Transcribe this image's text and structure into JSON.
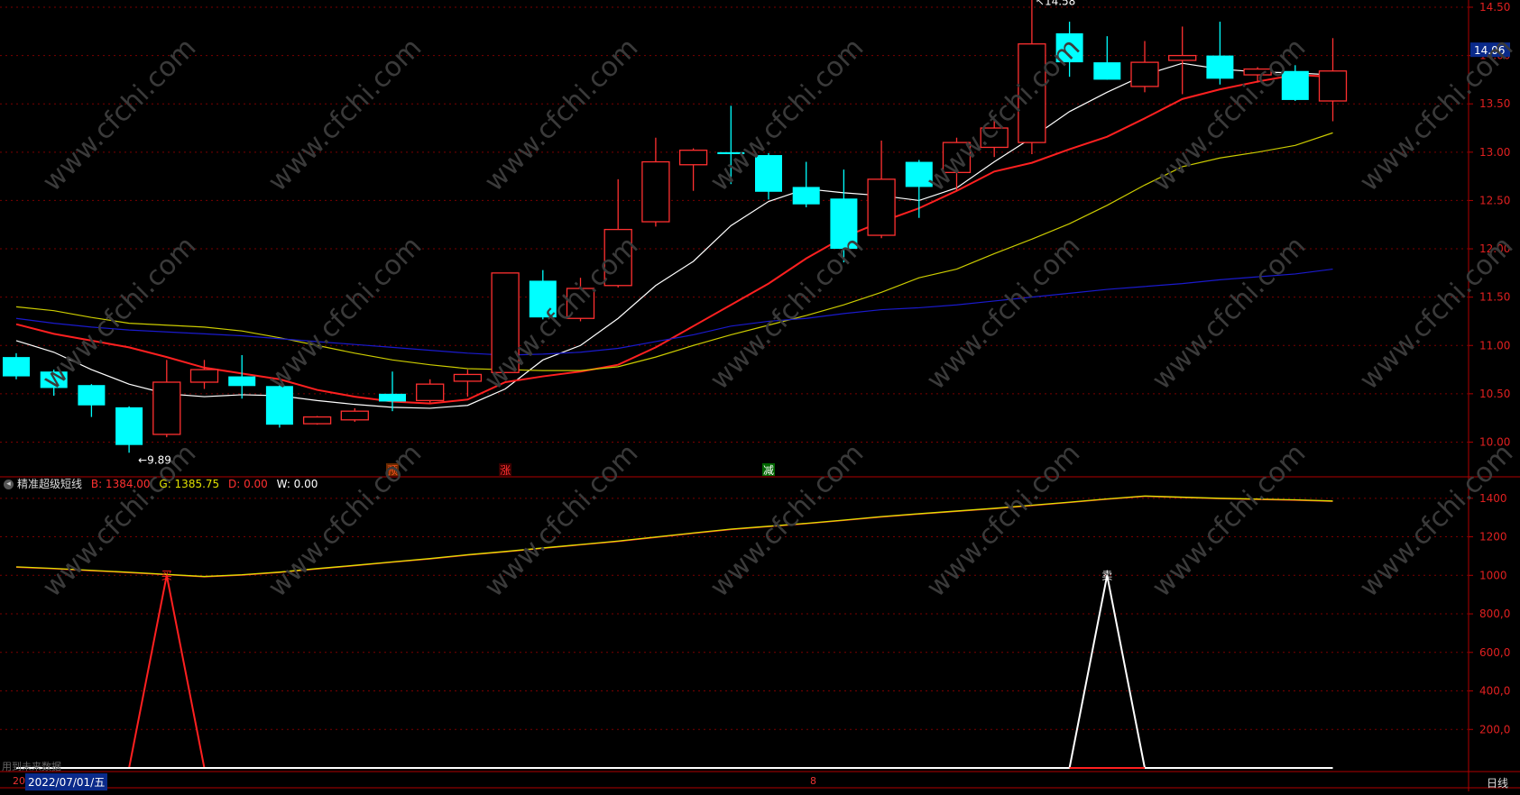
{
  "indicator": {
    "name": "精准超级短线",
    "toggle_icon": "collapse-icon",
    "b_label": "B: 1384.00",
    "g_label": "G: 1385.75",
    "d_label": "D: 0.00",
    "w_label": "W: 0.00",
    "b_color": "#ff3030",
    "g_color": "#e0e000",
    "d_color": "#ff3030",
    "w_color": "#ffffff"
  },
  "footer": {
    "note": "用到未来数据",
    "date": "2022/07/01/五",
    "period": "日线",
    "mark_a": "20",
    "mark_b": "8"
  },
  "watermark": "www.cfchi.com",
  "chart_data": [
    {
      "type": "candlestick",
      "y_ticks": [
        "14.50",
        "14.00",
        "13.50",
        "13.00",
        "12.50",
        "12.00",
        "11.50",
        "11.00",
        "10.50",
        "10.00"
      ],
      "ylim": [
        9.65,
        14.5
      ],
      "price_flag": "14.06",
      "high_label": "14.58",
      "low_label": "9.89",
      "up_color": "#ff3030",
      "down_color": "#00ffff",
      "candles": [
        {
          "o": 10.88,
          "h": 10.92,
          "l": 10.65,
          "c": 10.68
        },
        {
          "o": 10.73,
          "h": 10.75,
          "l": 10.48,
          "c": 10.56
        },
        {
          "o": 10.59,
          "h": 10.6,
          "l": 10.26,
          "c": 10.38
        },
        {
          "o": 10.36,
          "h": 10.37,
          "l": 9.89,
          "c": 9.97
        },
        {
          "o": 10.08,
          "h": 10.85,
          "l": 10.05,
          "c": 10.62
        },
        {
          "o": 10.62,
          "h": 10.85,
          "l": 10.55,
          "c": 10.75
        },
        {
          "o": 10.68,
          "h": 10.9,
          "l": 10.45,
          "c": 10.58
        },
        {
          "o": 10.58,
          "h": 10.6,
          "l": 10.15,
          "c": 10.18
        },
        {
          "o": 10.19,
          "h": 10.27,
          "l": 10.18,
          "c": 10.26
        },
        {
          "o": 10.23,
          "h": 10.35,
          "l": 10.21,
          "c": 10.32
        },
        {
          "o": 10.5,
          "h": 10.73,
          "l": 10.32,
          "c": 10.42
        },
        {
          "o": 10.43,
          "h": 10.65,
          "l": 10.41,
          "c": 10.6
        },
        {
          "o": 10.63,
          "h": 10.75,
          "l": 10.47,
          "c": 10.7
        },
        {
          "o": 10.72,
          "h": 11.75,
          "l": 10.72,
          "c": 11.75
        },
        {
          "o": 11.67,
          "h": 11.78,
          "l": 11.27,
          "c": 11.29
        },
        {
          "o": 11.28,
          "h": 11.7,
          "l": 11.25,
          "c": 11.59
        },
        {
          "o": 11.62,
          "h": 12.72,
          "l": 11.6,
          "c": 12.2
        },
        {
          "o": 12.28,
          "h": 13.15,
          "l": 12.23,
          "c": 12.9
        },
        {
          "o": 12.87,
          "h": 13.04,
          "l": 12.6,
          "c": 13.02
        },
        {
          "o": 13.0,
          "h": 13.48,
          "l": 12.67,
          "c": 12.98
        },
        {
          "o": 12.97,
          "h": 12.99,
          "l": 12.51,
          "c": 12.59
        },
        {
          "o": 12.64,
          "h": 12.9,
          "l": 12.43,
          "c": 12.46
        },
        {
          "o": 12.52,
          "h": 12.82,
          "l": 11.86,
          "c": 12.0
        },
        {
          "o": 12.14,
          "h": 13.12,
          "l": 12.11,
          "c": 12.72
        },
        {
          "o": 12.9,
          "h": 12.92,
          "l": 12.32,
          "c": 12.64
        },
        {
          "o": 12.79,
          "h": 13.15,
          "l": 12.6,
          "c": 13.1
        },
        {
          "o": 13.05,
          "h": 13.34,
          "l": 12.95,
          "c": 13.25
        },
        {
          "o": 13.1,
          "h": 14.58,
          "l": 12.98,
          "c": 14.12
        },
        {
          "o": 14.23,
          "h": 14.35,
          "l": 13.78,
          "c": 13.93
        },
        {
          "o": 13.93,
          "h": 14.2,
          "l": 13.75,
          "c": 13.75
        },
        {
          "o": 13.68,
          "h": 14.15,
          "l": 13.62,
          "c": 13.93
        },
        {
          "o": 13.95,
          "h": 14.3,
          "l": 13.6,
          "c": 14.0
        },
        {
          "o": 14.0,
          "h": 14.35,
          "l": 13.7,
          "c": 13.76
        },
        {
          "o": 13.8,
          "h": 13.88,
          "l": 13.72,
          "c": 13.86
        },
        {
          "o": 13.84,
          "h": 13.9,
          "l": 13.53,
          "c": 13.54
        },
        {
          "o": 13.53,
          "h": 14.18,
          "l": 13.32,
          "c": 13.84
        }
      ],
      "series": [
        {
          "color": "#ffffff",
          "values": [
            11.05,
            10.93,
            10.75,
            10.6,
            10.5,
            10.47,
            10.49,
            10.48,
            10.43,
            10.39,
            10.36,
            10.35,
            10.38,
            10.55,
            10.85,
            11.0,
            11.28,
            11.62,
            11.87,
            12.24,
            12.49,
            12.62,
            12.58,
            12.55,
            12.5,
            12.63,
            12.9,
            13.15,
            13.42,
            13.62,
            13.8,
            13.92,
            13.86,
            13.83,
            13.82,
            13.8
          ]
        },
        {
          "color": "#ff2020",
          "values": [
            11.22,
            11.12,
            11.05,
            10.98,
            10.88,
            10.77,
            10.71,
            10.65,
            10.54,
            10.47,
            10.42,
            10.4,
            10.44,
            10.62,
            10.68,
            10.73,
            10.8,
            10.98,
            11.2,
            11.42,
            11.64,
            11.9,
            12.12,
            12.28,
            12.42,
            12.6,
            12.8,
            12.89,
            13.03,
            13.16,
            13.35,
            13.55,
            13.65,
            13.73,
            13.8,
            13.78
          ]
        },
        {
          "color": "#cccc00",
          "values": [
            11.4,
            11.36,
            11.29,
            11.23,
            11.21,
            11.19,
            11.15,
            11.08,
            11.0,
            10.92,
            10.85,
            10.8,
            10.76,
            10.75,
            10.74,
            10.74,
            10.78,
            10.88,
            11.0,
            11.11,
            11.21,
            11.31,
            11.42,
            11.55,
            11.7,
            11.79,
            11.95,
            12.1,
            12.26,
            12.45,
            12.66,
            12.85,
            12.94,
            13.0,
            13.07,
            13.2
          ]
        },
        {
          "color": "#1a1acc",
          "values": [
            11.28,
            11.23,
            11.19,
            11.16,
            11.14,
            11.12,
            11.1,
            11.07,
            11.04,
            11.01,
            10.98,
            10.95,
            10.92,
            10.9,
            10.91,
            10.93,
            10.97,
            11.04,
            11.11,
            11.2,
            11.25,
            11.28,
            11.33,
            11.37,
            11.39,
            11.42,
            11.46,
            11.5,
            11.54,
            11.58,
            11.61,
            11.64,
            11.68,
            11.71,
            11.74,
            11.79
          ]
        }
      ],
      "markers": [
        {
          "i": 10,
          "text": "预",
          "color": "#ff5020",
          "bg": "#6a2a00"
        },
        {
          "i": 13,
          "text": "涨",
          "color": "#ff3030",
          "bg": "#3a0000"
        },
        {
          "i": 20,
          "text": "减",
          "color": "#ffffff",
          "bg": "#006600"
        }
      ]
    },
    {
      "type": "line",
      "y_ticks": [
        "1400",
        "1200",
        "1000",
        "800,0",
        "600,0",
        "400,0",
        "200,0"
      ],
      "ylim": [
        0,
        1460
      ],
      "series": [
        {
          "name": "B",
          "color": "#ff3030",
          "values": [
            1042,
            1034,
            1024,
            1014,
            1003,
            992,
            1001,
            1015,
            1033,
            1050,
            1068,
            1085,
            1105,
            1122,
            1140,
            1158,
            1176,
            1197,
            1218,
            1238,
            1253,
            1268,
            1285,
            1303,
            1318,
            1332,
            1346,
            1362,
            1378,
            1395,
            1410,
            1404,
            1398,
            1394,
            1390,
            1384
          ]
        },
        {
          "name": "G",
          "color": "#e0e000",
          "values": [
            1044,
            1036,
            1026,
            1016,
            1005,
            994,
            1003,
            1017,
            1035,
            1052,
            1070,
            1087,
            1107,
            1124,
            1142,
            1160,
            1178,
            1199,
            1220,
            1240,
            1255,
            1270,
            1287,
            1305,
            1320,
            1334,
            1348,
            1364,
            1380,
            1397,
            1412,
            1406,
            1400,
            1396,
            1392,
            1386
          ]
        },
        {
          "name": "D",
          "color": "#ff2020",
          "values": [
            0,
            0,
            0,
            0,
            1000,
            0,
            0,
            0,
            0,
            0,
            0,
            0,
            0,
            0,
            0,
            0,
            0,
            0,
            0,
            0,
            0,
            0,
            0,
            0,
            0,
            0,
            0,
            0,
            0,
            0,
            0,
            0,
            0,
            0,
            0,
            0
          ]
        },
        {
          "name": "W",
          "color": "#ffffff",
          "values": [
            0,
            0,
            0,
            0,
            0,
            0,
            0,
            0,
            0,
            0,
            0,
            0,
            0,
            0,
            0,
            0,
            0,
            0,
            0,
            0,
            0,
            0,
            0,
            0,
            0,
            0,
            0,
            0,
            0,
            1000,
            0,
            0,
            0,
            0,
            0,
            0
          ]
        }
      ],
      "signals": [
        {
          "i": 4,
          "text": "买",
          "color": "#ff2020"
        },
        {
          "i": 29,
          "text": "卖",
          "color": "#ffffff"
        }
      ]
    }
  ]
}
